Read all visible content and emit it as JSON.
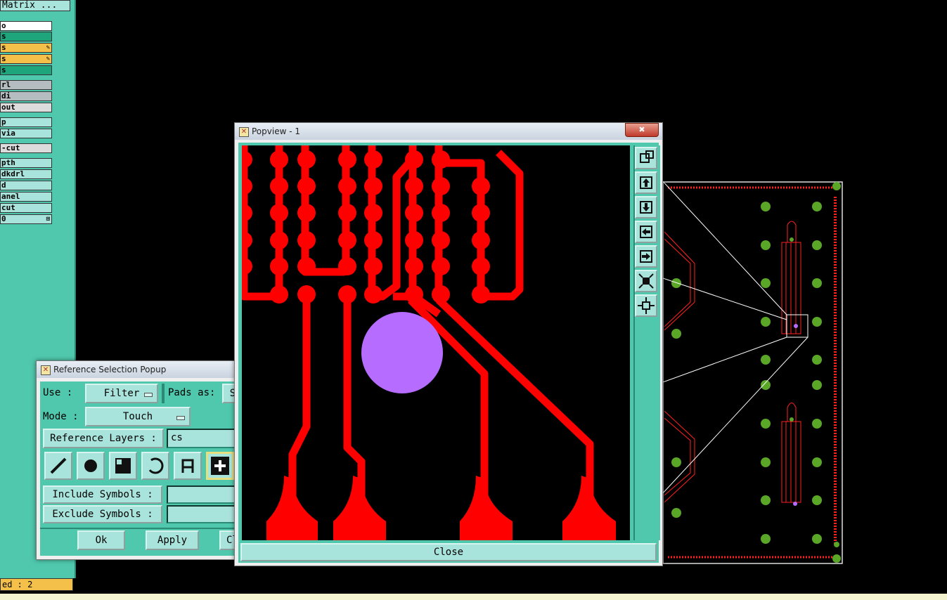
{
  "left_panel": {
    "title": "Matrix ...",
    "layers": [
      {
        "label": "o",
        "color": "#ffffff",
        "marker": ""
      },
      {
        "label": "s",
        "color": "#1ea57c",
        "marker": ""
      },
      {
        "label": "s",
        "color": "#f5c04a",
        "marker": "✎"
      },
      {
        "label": "s",
        "color": "#f5c04a",
        "marker": "✎"
      },
      {
        "label": "s",
        "color": "#1ea57c",
        "marker": ""
      },
      {
        "label": "rl",
        "color": "#b6bdc0",
        "marker": ""
      },
      {
        "label": "di",
        "color": "#b6bdc0",
        "marker": ""
      },
      {
        "label": "out",
        "color": "#dcdcdc",
        "marker": ""
      },
      {
        "label": "p",
        "color": "#a9e4dc",
        "marker": ""
      },
      {
        "label": "via",
        "color": "#a9e4dc",
        "marker": ""
      },
      {
        "label": "-cut",
        "color": "#dcdcdc",
        "marker": ""
      },
      {
        "label": "pth",
        "color": "#a9e4dc",
        "marker": ""
      },
      {
        "label": "dkdrl",
        "color": "#a9e4dc",
        "marker": ""
      },
      {
        "label": "d",
        "color": "#a9e4dc",
        "marker": ""
      },
      {
        "label": "anel",
        "color": "#a9e4dc",
        "marker": ""
      },
      {
        "label": "cut",
        "color": "#a9e4dc",
        "marker": ""
      },
      {
        "label": "0",
        "color": "#a9e4dc",
        "marker": "⊞"
      }
    ],
    "status": "ed : 2"
  },
  "reference_popup": {
    "title": "Reference Selection Popup",
    "use_label": "Use  :",
    "use_value": "Filter",
    "pads_label": "Pads as:",
    "pads_value": "S",
    "mode_label": "Mode :",
    "mode_value": "Touch",
    "reference_layers_label": "Reference Layers :",
    "reference_layers_value": "cs",
    "include_symbols_label": "Include Symbols :",
    "include_symbols_value": "",
    "exclude_symbols_label": "Exclude Symbols :",
    "exclude_symbols_value": "",
    "ok_label": "Ok",
    "apply_label": "Apply",
    "close_label": "Cl"
  },
  "popview": {
    "title": "Popview - 1",
    "close_x": "✖",
    "close_label": "Close",
    "side_icons": [
      "zoom-window-icon",
      "pan-up-icon",
      "pan-down-icon",
      "pan-left-icon",
      "pan-right-icon",
      "zoom-fit-icon",
      "zoom-center-icon"
    ]
  },
  "colors": {
    "panel": "#4fc8ad",
    "button": "#a9e4dc",
    "trace": "#ff0000",
    "pad": "#5aa728",
    "highlight": "#b56cff"
  }
}
